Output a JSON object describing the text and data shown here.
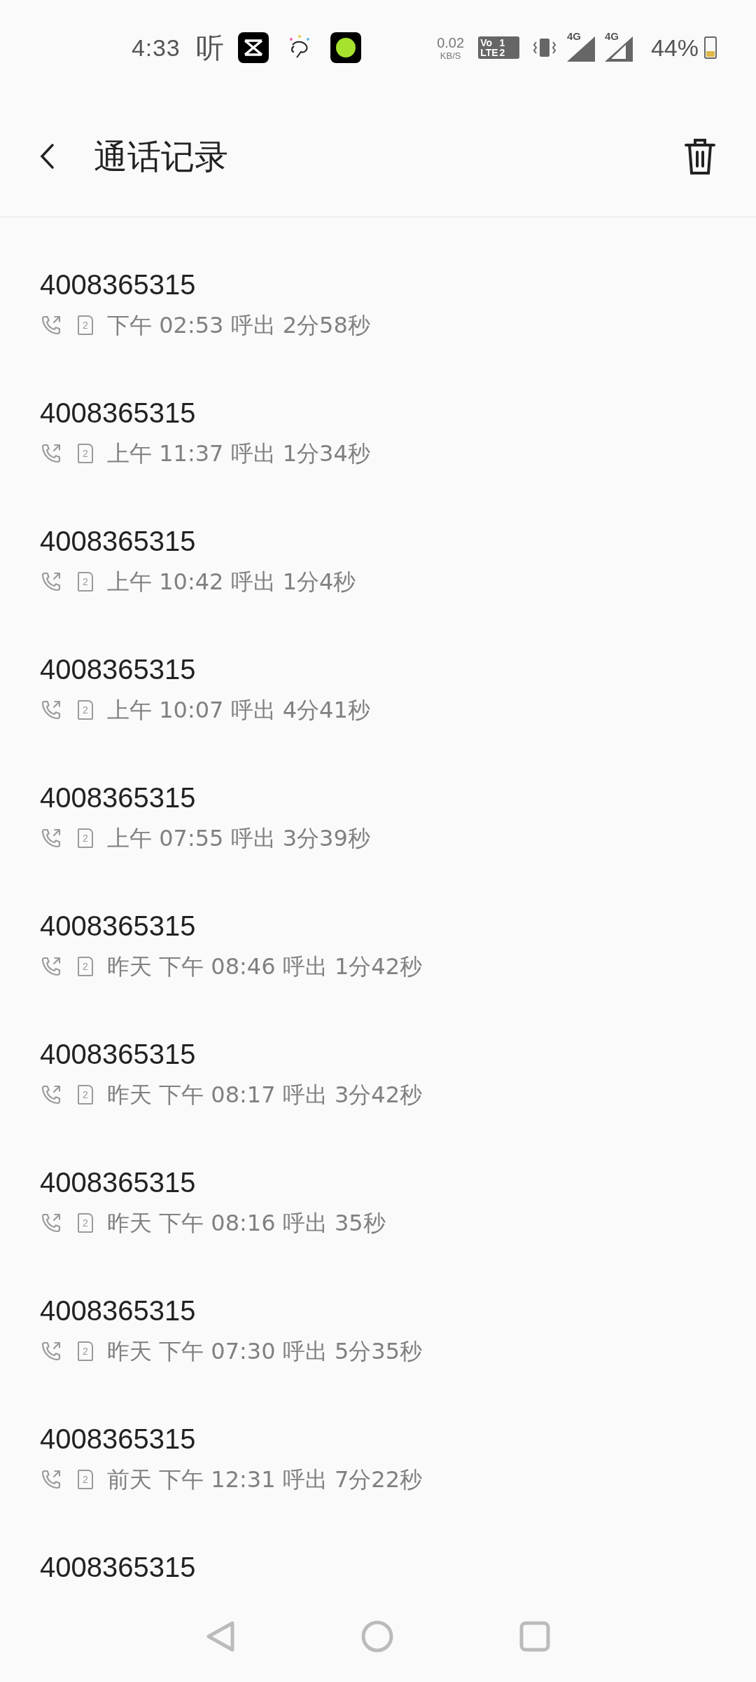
{
  "status_bar": {
    "time": "4:33",
    "app_glyph": "听",
    "speed_value": "0.02",
    "speed_unit": "KB/S",
    "volte": [
      "Vo",
      "1",
      "LTE",
      "2"
    ],
    "network_labels": [
      "4G",
      "4G"
    ],
    "battery": "44%",
    "battery_icon": {
      "level": 0.3
    }
  },
  "header": {
    "title": "通话记录"
  },
  "calls": [
    {
      "number": "4008365315",
      "sim": "2",
      "detail": "下午 02:53 呼出 2分58秒"
    },
    {
      "number": "4008365315",
      "sim": "2",
      "detail": "上午 11:37 呼出 1分34秒"
    },
    {
      "number": "4008365315",
      "sim": "2",
      "detail": "上午 10:42 呼出 1分4秒"
    },
    {
      "number": "4008365315",
      "sim": "2",
      "detail": "上午 10:07 呼出 4分41秒"
    },
    {
      "number": "4008365315",
      "sim": "2",
      "detail": "上午 07:55 呼出 3分39秒"
    },
    {
      "number": "4008365315",
      "sim": "2",
      "detail": "昨天 下午 08:46 呼出 1分42秒"
    },
    {
      "number": "4008365315",
      "sim": "2",
      "detail": "昨天 下午 08:17 呼出 3分42秒"
    },
    {
      "number": "4008365315",
      "sim": "2",
      "detail": "昨天 下午 08:16 呼出 35秒"
    },
    {
      "number": "4008365315",
      "sim": "2",
      "detail": "昨天 下午 07:30 呼出 5分35秒"
    },
    {
      "number": "4008365315",
      "sim": "2",
      "detail": "前天 下午 12:31 呼出 7分22秒"
    },
    {
      "number": "4008365315"
    }
  ]
}
